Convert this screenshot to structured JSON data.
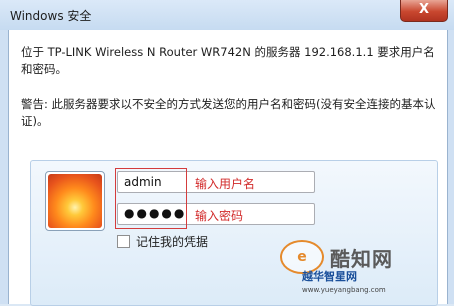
{
  "window": {
    "title": "Windows 安全",
    "close_label": "X"
  },
  "message": {
    "line1": "位于 TP-LINK Wireless N Router WR742N 的服务器 192.168.1.1 要求用户名和密码。",
    "warning": "警告: 此服务器要求以不安全的方式发送您的用户名和密码(没有安全连接的基本认证)。"
  },
  "credentials": {
    "username_value": "admin",
    "password_value": "●●●●●",
    "username_hint": "输入用户名",
    "password_hint": "输入密码",
    "remember_label": "记住我的凭据"
  },
  "watermark": {
    "site_name": "酷知网",
    "site_logo_char": "e",
    "site2_name": "越华智星网",
    "site2_url": "www.yueyangbang.com"
  },
  "colors": {
    "annotation": "#d43c3c",
    "title_bg": "#c6dbf1",
    "close_button": "#c9472f"
  }
}
